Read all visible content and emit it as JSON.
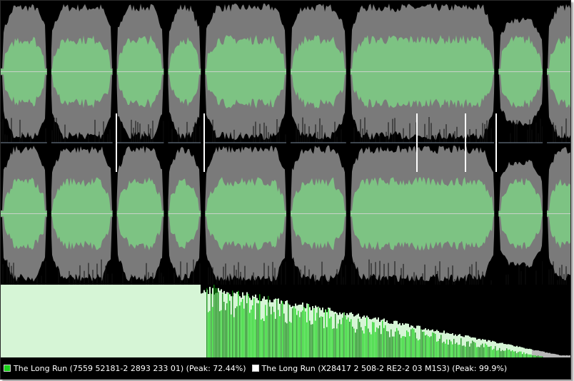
{
  "colors": {
    "background": "#000000",
    "waveform_outer": "#7a7a7a",
    "waveform_rms": "#7dc383",
    "centerline": "#c9d2c9",
    "series_a": "#19d319",
    "series_b": "#ffffff"
  },
  "legend": {
    "series_a": {
      "label": "The Long Run (7559 52181-2 2893 233 01)",
      "peak_label": "(Peak: 72.44%)",
      "swatch_color": "#19d319",
      "peak_percent": 72.44
    },
    "series_b": {
      "label": "The Long Run (X28417 2 508-2 RE2-2 03 M1S3)",
      "peak_label": "(Peak: 99.9%)",
      "swatch_color": "#ffffff",
      "peak_percent": 99.9
    }
  },
  "waveform": {
    "channels": 2,
    "track_gaps": [
      0.0,
      0.085,
      0.2,
      0.29,
      0.355,
      0.505,
      0.61,
      0.87,
      0.955
    ]
  }
}
